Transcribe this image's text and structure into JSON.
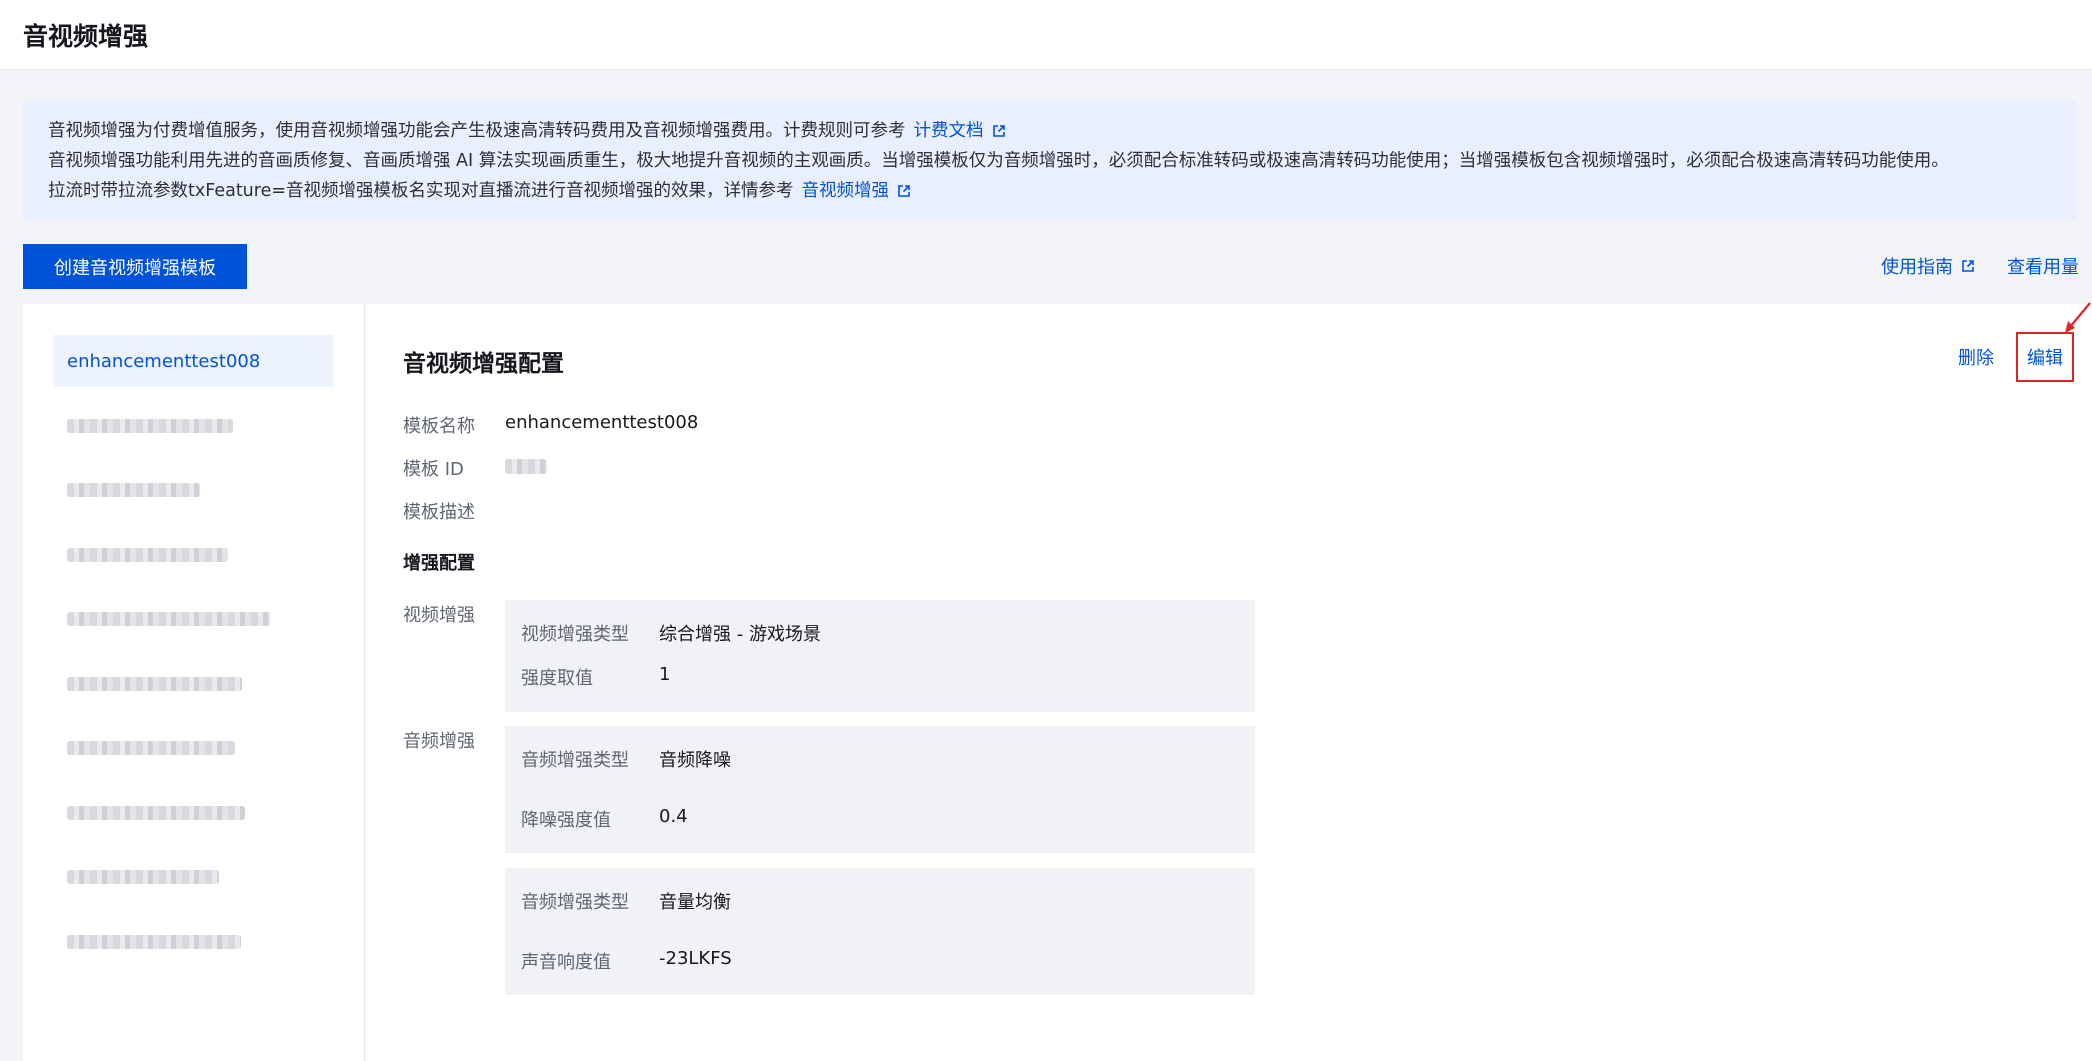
{
  "page": {
    "title": "音视频增强"
  },
  "notice": {
    "line1_text": "音视频增强为付费增值服务，使用音视频增强功能会产生极速高清转码费用及音视频增强费用。计费规则可参考",
    "line1_link": "计费文档",
    "line2_text": "音视频增强功能利用先进的音画质修复、音画质增强 AI 算法实现画质重生，极大地提升音视频的主观画质。当增强模板仅为音频增强时，必须配合标准转码或极速高清转码功能使用；当增强模板包含视频增强时，必须配合极速高清转码功能使用。",
    "line3_text": "拉流时带拉流参数txFeature=音视频增强模板名实现对直播流进行音视频增强的效果，详情参考",
    "line3_link": "音视频增强"
  },
  "toolbar": {
    "create_label": "创建音视频增强模板",
    "guide_label": "使用指南",
    "usage_label": "查看用量"
  },
  "sidebar": {
    "active_item": "enhancementtest008",
    "blurred_count": 9
  },
  "config": {
    "title": "音视频增强配置",
    "delete_label": "删除",
    "edit_label": "编辑",
    "template_name_label": "模板名称",
    "template_name_value": "enhancementtest008",
    "template_id_label": "模板 ID",
    "template_desc_label": "模板描述",
    "enhance_section_label": "增强配置",
    "video_label": "视频增强",
    "video_box": {
      "type_label": "视频增强类型",
      "type_value": "综合增强 - 游戏场景",
      "strength_label": "强度取值",
      "strength_value": "1"
    },
    "audio_label": "音频增强",
    "audio_box1": {
      "type_label": "音频增强类型",
      "type_value": "音频降噪",
      "param_label": "降噪强度值",
      "param_value": "0.4"
    },
    "audio_box2": {
      "type_label": "音频增强类型",
      "type_value": "音量均衡",
      "param_label": "声音响度值",
      "param_value": "-23LKFS"
    }
  },
  "colors": {
    "primary": "#0052d9",
    "highlight": "#e02424",
    "notice_bg": "#e9efff"
  }
}
